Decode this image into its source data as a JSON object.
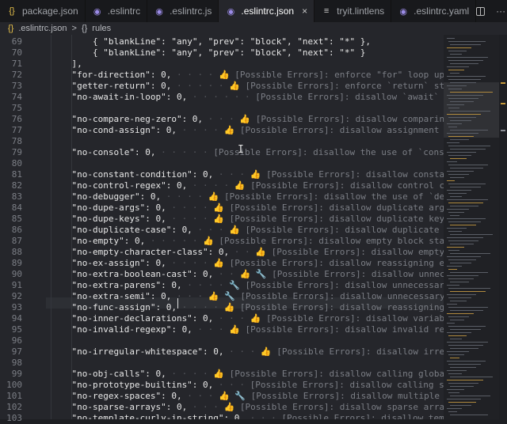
{
  "tabs": [
    {
      "label": "package.json",
      "icon": "json-braces-icon",
      "icon_glyph": "{}",
      "icon_color": "#e8c24a",
      "active": false
    },
    {
      "label": ".eslintrc",
      "icon": "eslint-icon",
      "icon_glyph": "◉",
      "icon_color": "#9b8be6",
      "active": false
    },
    {
      "label": ".eslintrc.js",
      "icon": "eslint-icon",
      "icon_glyph": "◉",
      "icon_color": "#9b8be6",
      "active": false
    },
    {
      "label": ".eslintrc.json",
      "icon": "eslint-icon",
      "icon_glyph": "◉",
      "icon_color": "#9b8be6",
      "active": true,
      "close": "×"
    },
    {
      "label": "tryit.lintlens",
      "icon": "list-lines-icon",
      "icon_glyph": "≡",
      "icon_color": "#c8c8c8",
      "active": false
    },
    {
      "label": ".eslintrc.yaml",
      "icon": "eslint-icon",
      "icon_glyph": "◉",
      "icon_color": "#9b8be6",
      "active": false
    }
  ],
  "breadcrumb": {
    "file": ".eslintrc.json",
    "sep": ">",
    "symbol_icon": "{}",
    "symbol": "rules"
  },
  "more_glyph": "···",
  "code_lines": [
    {
      "n": "69",
      "parts": [
        [
          "        {",
          "k"
        ],
        [
          " \"blankLine\": \"any\", \"prev\": \"block\", \"next\": \"*\" },",
          "s"
        ]
      ]
    },
    {
      "n": "70",
      "parts": [
        [
          "        {",
          "k"
        ],
        [
          " \"blankLine\": \"any\", \"prev\": \"block\", \"next\": \"*\" }",
          "s"
        ]
      ]
    },
    {
      "n": "71",
      "parts": [
        [
          "    ],",
          "k"
        ]
      ]
    },
    {
      "n": "72",
      "parts": [
        [
          "    \"for-direction\": 0,",
          "k"
        ],
        [
          " · · · · ",
          "dots"
        ],
        [
          "👍 ",
          "thumb"
        ],
        [
          "[Possible Errors]: enforce \"for\" loop update clause mo",
          "c"
        ]
      ]
    },
    {
      "n": "73",
      "parts": [
        [
          "    \"getter-return\": 0,",
          "k"
        ],
        [
          " · · · · · ",
          "dots"
        ],
        [
          "👍 ",
          "thumb"
        ],
        [
          "[Possible Errors]: enforce `return` statements in ge",
          "c"
        ]
      ]
    },
    {
      "n": "74",
      "parts": [
        [
          "    \"no-await-in-loop\": 0,",
          "k"
        ],
        [
          " · · · · · · ",
          "dots"
        ],
        [
          "[Possible Errors]: disallow `await` inside of loops",
          "c"
        ]
      ]
    },
    {
      "n": "75",
      "parts": []
    },
    {
      "n": "76",
      "parts": [
        [
          "    \"no-compare-neg-zero\": 0,",
          "k"
        ],
        [
          " · · · ",
          "dots"
        ],
        [
          "👍 ",
          "thumb"
        ],
        [
          "[Possible Errors]: disallow comparing against -",
          "c"
        ]
      ]
    },
    {
      "n": "77",
      "parts": [
        [
          "    \"no-cond-assign\": 0,",
          "k"
        ],
        [
          " · · · · ",
          "dots"
        ],
        [
          "👍 ",
          "thumb"
        ],
        [
          "[Possible Errors]: disallow assignment operators in",
          "c"
        ]
      ]
    },
    {
      "n": "78",
      "parts": []
    },
    {
      "n": "79",
      "parts": [
        [
          "    \"no-console\": 0,",
          "k"
        ],
        [
          " · · · · · ",
          "dots"
        ],
        [
          "[Possible Errors]: disallow the use of `console`",
          "c"
        ]
      ]
    },
    {
      "n": "80",
      "parts": []
    },
    {
      "n": "81",
      "parts": [
        [
          "    \"no-constant-condition\": 0,",
          "k"
        ],
        [
          " · · · ",
          "dots"
        ],
        [
          "👍 ",
          "thumb"
        ],
        [
          "[Possible Errors]: disallow constant expressi",
          "c"
        ]
      ]
    },
    {
      "n": "82",
      "parts": [
        [
          "    \"no-control-regex\": 0,",
          "k"
        ],
        [
          " · · · · ",
          "dots"
        ],
        [
          "👍 ",
          "thumb"
        ],
        [
          "[Possible Errors]: disallow control characters in",
          "c"
        ]
      ]
    },
    {
      "n": "83",
      "parts": [
        [
          "    \"no-debugger\": 0,",
          "k"
        ],
        [
          " · · · · ",
          "dots"
        ],
        [
          "👍 ",
          "thumb"
        ],
        [
          "[Possible Errors]: disallow the use of `debugger`",
          "c"
        ]
      ]
    },
    {
      "n": "84",
      "parts": [
        [
          "    \"no-dupe-args\": 0,",
          "k"
        ],
        [
          " · · · · ",
          "dots"
        ],
        [
          "👍 ",
          "thumb"
        ],
        [
          "[Possible Errors]: disallow duplicate arguments in `fu",
          "c"
        ]
      ]
    },
    {
      "n": "85",
      "parts": [
        [
          "    \"no-dupe-keys\": 0,",
          "k"
        ],
        [
          " · · · · ",
          "dots"
        ],
        [
          "👍 ",
          "thumb"
        ],
        [
          "[Possible Errors]: disallow duplicate keys in object l",
          "c"
        ]
      ]
    },
    {
      "n": "86",
      "parts": [
        [
          "    \"no-duplicate-case\": 0,",
          "k"
        ],
        [
          " · · · ",
          "dots"
        ],
        [
          "👍 ",
          "thumb"
        ],
        [
          "[Possible Errors]: disallow duplicate case labels",
          "c"
        ]
      ]
    },
    {
      "n": "87",
      "parts": [
        [
          "    \"no-empty\": 0,",
          "k"
        ],
        [
          " · · · · · ",
          "dots"
        ],
        [
          "👍 ",
          "thumb"
        ],
        [
          "[Possible Errors]: disallow empty block statements",
          "c"
        ]
      ]
    },
    {
      "n": "88",
      "parts": [
        [
          "    \"no-empty-character-class\": 0,",
          "k"
        ],
        [
          " · · ",
          "dots"
        ],
        [
          "👍 ",
          "thumb"
        ],
        [
          "[Possible Errors]: disallow empty characte",
          "c"
        ]
      ]
    },
    {
      "n": "89",
      "parts": [
        [
          "    \"no-ex-assign\": 0,",
          "k"
        ],
        [
          " · · · · ",
          "dots"
        ],
        [
          "👍 ",
          "thumb"
        ],
        [
          "[Possible Errors]: disallow reassigning exceptions in",
          "c"
        ]
      ]
    },
    {
      "n": "90",
      "parts": [
        [
          "    \"no-extra-boolean-cast\": 0,",
          "k"
        ],
        [
          " · · ",
          "dots"
        ],
        [
          "👍 🔧 ",
          "thumb"
        ],
        [
          "[Possible Errors]: disallow unnecessary bo",
          "c"
        ]
      ]
    },
    {
      "n": "91",
      "parts": [
        [
          "    \"no-extra-parens\": 0,",
          "k"
        ],
        [
          " · · · · ",
          "dots"
        ],
        [
          "🔧 ",
          "thumb"
        ],
        [
          "[Possible Errors]: disallow unnecessary parenthese",
          "c"
        ]
      ]
    },
    {
      "n": "92",
      "parts": [
        [
          "    \"no-extra-semi\": 0,",
          "k"
        ],
        [
          " · · · ",
          "dots"
        ],
        [
          "👍 🔧 ",
          "thumb"
        ],
        [
          "[Possible Errors]: disallow unnecessary semicolons",
          "c"
        ]
      ]
    },
    {
      "n": "93",
      "parts": [
        [
          "    \"no-func-assign\": 0,",
          "k"
        ],
        [
          " · · · · ",
          "dots"
        ],
        [
          "👍 ",
          "thumb"
        ],
        [
          "[Possible Errors]: disallow reassigning `function` d",
          "c"
        ]
      ]
    },
    {
      "n": "94",
      "parts": [
        [
          "    \"no-inner-declarations\": 0,",
          "k"
        ],
        [
          " · · · ",
          "dots"
        ],
        [
          "👍 ",
          "thumb"
        ],
        [
          "[Possible Errors]: disallow variable or `func",
          "c"
        ]
      ]
    },
    {
      "n": "95",
      "parts": [
        [
          "    \"no-invalid-regexp\": 0,",
          "k"
        ],
        [
          " · · · ",
          "dots"
        ],
        [
          "👍 ",
          "thumb"
        ],
        [
          "[Possible Errors]: disallow invalid regular expre",
          "c"
        ]
      ]
    },
    {
      "n": "96",
      "parts": []
    },
    {
      "n": "97",
      "parts": [
        [
          "    \"no-irregular-whitespace\": 0,",
          "k"
        ],
        [
          " · · · ",
          "dots"
        ],
        [
          "👍 ",
          "thumb"
        ],
        [
          "[Possible Errors]: disallow irregular white",
          "c"
        ]
      ]
    },
    {
      "n": "98",
      "parts": []
    },
    {
      "n": "99",
      "parts": [
        [
          "    \"no-obj-calls\": 0,",
          "k"
        ],
        [
          " · · · · ",
          "dots"
        ],
        [
          "👍 ",
          "thumb"
        ],
        [
          "[Possible Errors]: disallow calling global object prop",
          "c"
        ]
      ]
    },
    {
      "n": "100",
      "parts": [
        [
          "    \"no-prototype-builtins\": 0,",
          "k"
        ],
        [
          " · · · ",
          "dots"
        ],
        [
          "[Possible Errors]: disallow calling some `Obj",
          "c"
        ]
      ]
    },
    {
      "n": "101",
      "parts": [
        [
          "    \"no-regex-spaces\": 0,",
          "k"
        ],
        [
          " · · · ",
          "dots"
        ],
        [
          "👍 🔧 ",
          "thumb"
        ],
        [
          "[Possible Errors]: disallow multiple spaces in r",
          "c"
        ]
      ]
    },
    {
      "n": "102",
      "parts": [
        [
          "    \"no-sparse-arrays\": 0,",
          "k"
        ],
        [
          " · · · ",
          "dots"
        ],
        [
          "👍 ",
          "thumb"
        ],
        [
          "[Possible Errors]: disallow sparse arrays",
          "c"
        ]
      ]
    },
    {
      "n": "103",
      "parts": [
        [
          "    \"no-template-curly-in-string\": 0,",
          "k"
        ],
        [
          " · · · ",
          "dots"
        ],
        [
          "[Possible Errors]: disallow template liter",
          "c"
        ]
      ]
    }
  ]
}
